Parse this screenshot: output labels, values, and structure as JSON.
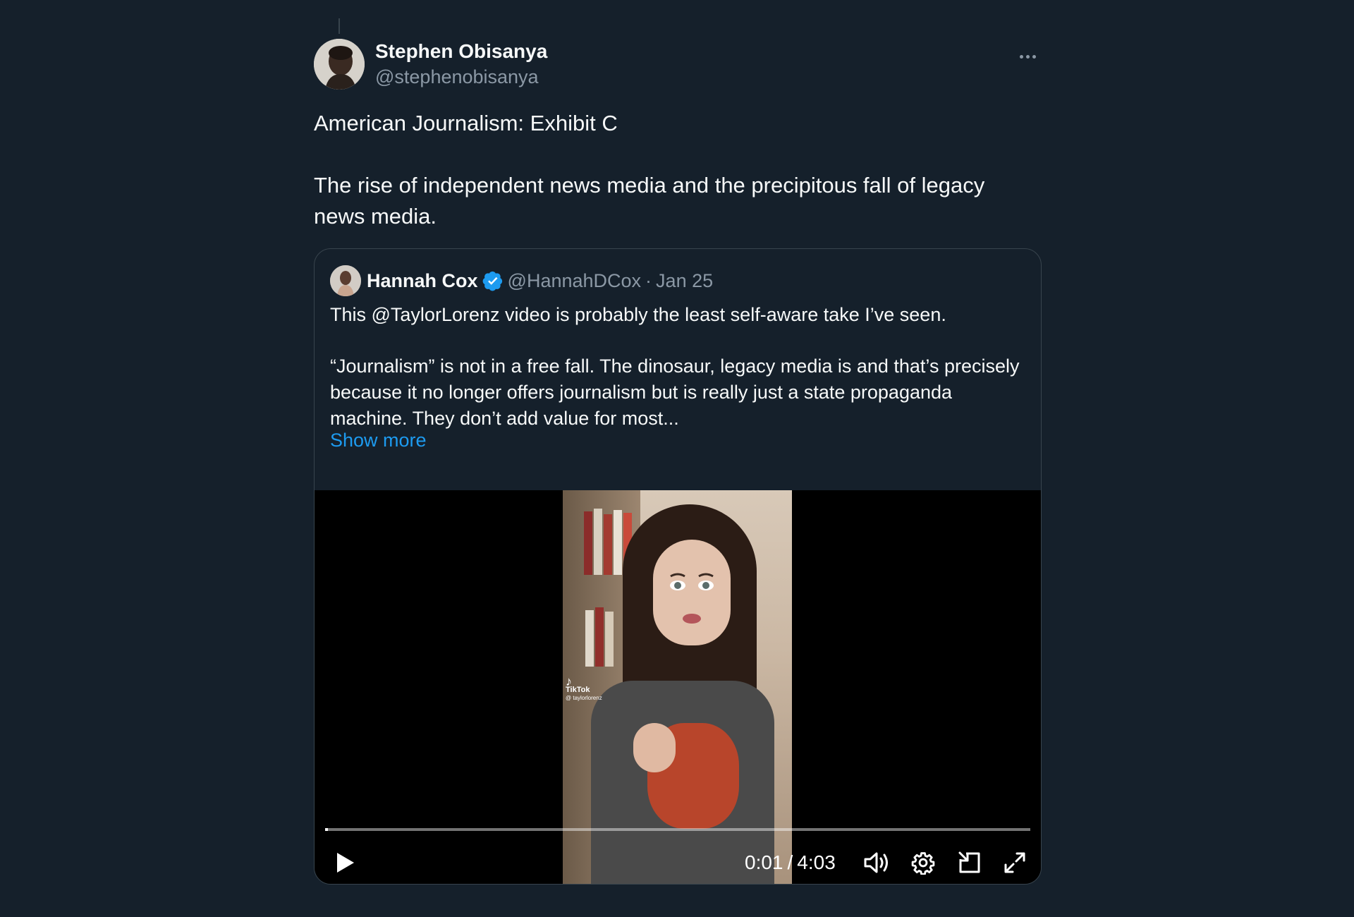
{
  "tweet": {
    "author": {
      "display_name": "Stephen Obisanya",
      "handle": "@stephenobisanya"
    },
    "text_line1": "American Journalism: Exhibit C",
    "text_line2": "The rise of independent news media and the precipitous fall of legacy news media."
  },
  "quote": {
    "author": {
      "display_name": "Hannah Cox",
      "handle": "@HannahDCox",
      "separator": "·",
      "date": "Jan 25",
      "verified": true
    },
    "text_line1": "This @TaylorLorenz video is probably the least self-aware take I’ve seen.",
    "text_line2": "“Journalism” is not in a free fall. The dinosaur, legacy media is and that’s precisely because it no longer offers journalism but is really just a state propaganda machine. They don’t add value for most...",
    "show_more": "Show more"
  },
  "video": {
    "watermark_brand": "TikTok",
    "watermark_handle": "@ taylorlorenz",
    "current_time": "0:01",
    "time_separator": "/",
    "duration": "4:03",
    "progress_fraction": 0.004
  },
  "colors": {
    "background": "#15202b",
    "accent": "#1d9bf0",
    "secondary_text": "#8b98a5",
    "border": "#38444d"
  },
  "icons": {
    "more": "more-horizontal-icon",
    "verified": "verified-badge-icon",
    "play": "play-icon",
    "volume": "volume-icon",
    "settings": "gear-icon",
    "docking": "dock-icon",
    "fullscreen": "fullscreen-icon"
  }
}
